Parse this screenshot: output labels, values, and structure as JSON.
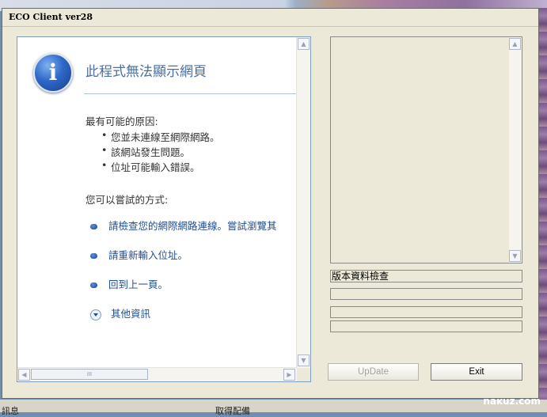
{
  "window": {
    "title": "ECO Client ver28"
  },
  "browser": {
    "heading": "此程式無法顯示網頁",
    "reasons_label": "最有可能的原因:",
    "reasons": [
      "您並未連線至網際網路。",
      "該網站發生問題。",
      "位址可能輸入錯誤。"
    ],
    "try_label": "您可以嘗試的方式:",
    "suggestions": [
      "請檢查您的網際網路連線。嘗試瀏覽其",
      "請重新輸入位址。",
      "回到上一頁。"
    ],
    "more_info": "其他資訊",
    "scroll_grip": "III"
  },
  "panel": {
    "status_text": "版本資料檢查",
    "update_label": "UpDate",
    "exit_label": "Exit"
  },
  "desktop": {
    "bottom_left": "訊息",
    "bottom_mid": "取得配備",
    "watermark": "nakuz.com"
  },
  "icons": [
    "info-icon",
    "chevron-up-icon",
    "chevron-down-icon",
    "chevron-left-icon",
    "chevron-right-icon",
    "expand-icon"
  ]
}
